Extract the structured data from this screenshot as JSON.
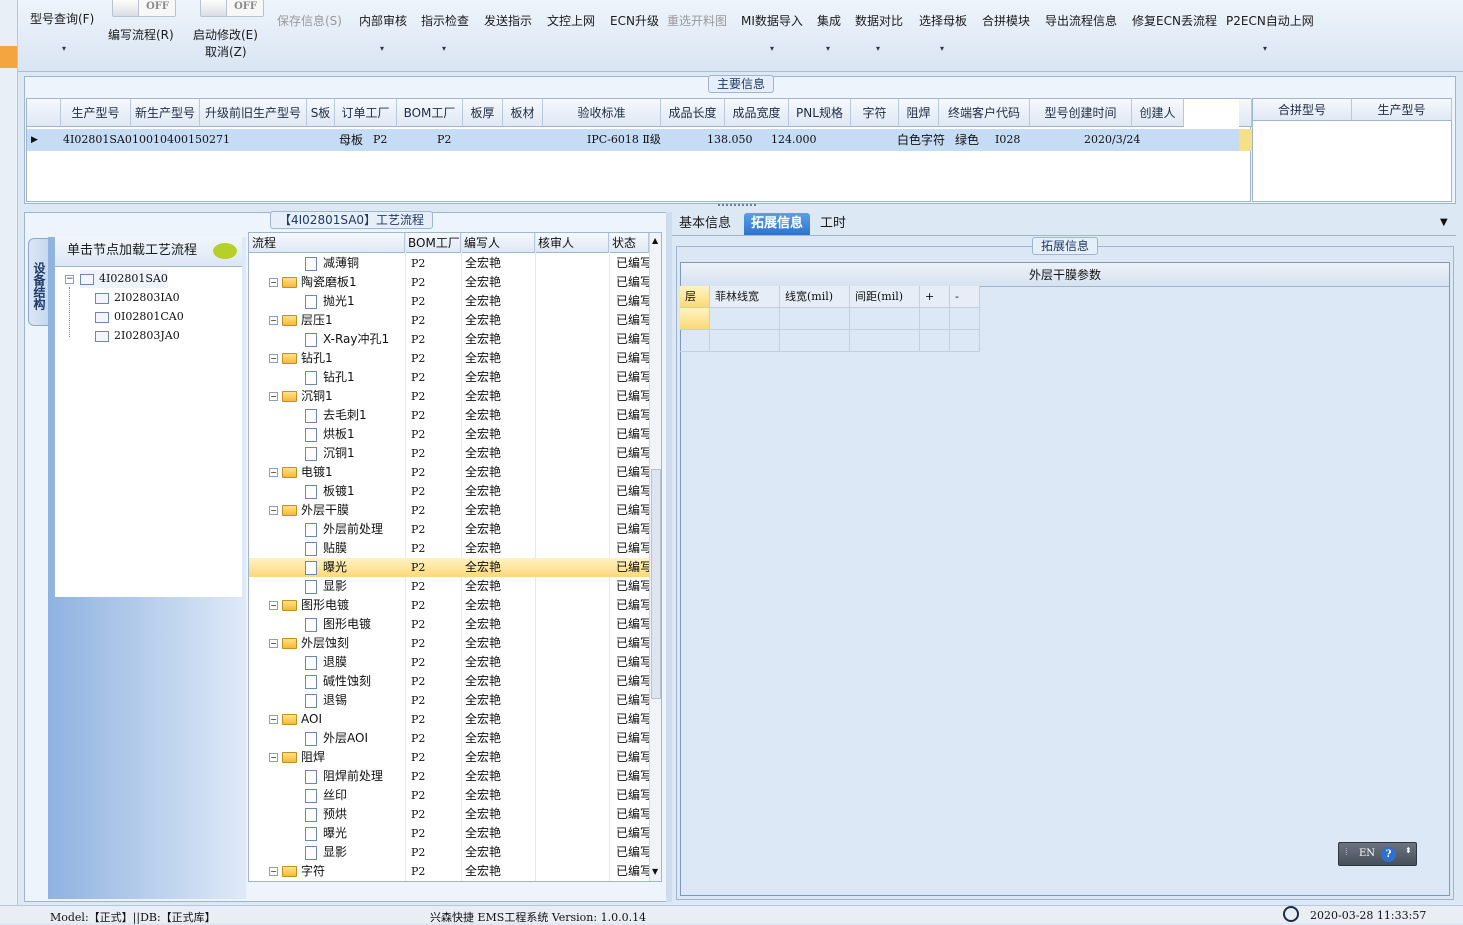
{
  "toolbar": {
    "query": "型号查询(F)",
    "write_flow": "编写流程(R)",
    "enable_edit": "启动修改(E)",
    "cancel": "取消(Z)",
    "toggle_off": "OFF",
    "save_info": "保存信息(S)",
    "internal_review": "内部审核",
    "instruction_check": "指示检查",
    "send_instruction": "发送指示",
    "doc_online": "文控上网",
    "ecn_upgrade": "ECN升级",
    "reopen_cut": "重选开料图",
    "mi_import": "MI数据导入",
    "integrate": "集成",
    "data_compare": "数据对比",
    "select_mother": "选择母板",
    "merge_module": "合拼模块",
    "export_flow": "导出流程信息",
    "fix_ecn": "修复ECN丢流程",
    "p2ecn_auto": "P2ECN自动上网"
  },
  "main_info": {
    "title": "主要信息",
    "columns": [
      "生产型号",
      "新生产型号",
      "升级前旧生产型号",
      "S板",
      "订单工厂",
      "BOM工厂",
      "板厚",
      "板材",
      "验收标准",
      "成品长度",
      "成品宽度",
      "PNL规格",
      "字符",
      "阻焊",
      "终端客户代码",
      "型号创建时间",
      "创建人"
    ],
    "row": {
      "prod_model": "4I02801SA0",
      "new_model": "10010400150271",
      "s_board": "母板",
      "order_factory": "P2",
      "bom_factory": "P2",
      "standard": "IPC-6018 Ⅱ级",
      "length": "138.050",
      "width": "124.000",
      "char": "白色字符",
      "solder": "绿色",
      "customer_code": "I028",
      "created": "2020/3/24"
    },
    "merge_columns": [
      "合拼型号",
      "生产型号"
    ]
  },
  "structure": {
    "vtab": "设备结构",
    "header": "单击节点加载工艺流程",
    "nodes": [
      "4I02801SA0",
      "2I02803IA0",
      "0I02801CA0",
      "2I02803JA0"
    ]
  },
  "flow": {
    "title": "【4I02801SA0】工艺流程",
    "columns": [
      "流程",
      "BOM工厂",
      "编写人",
      "核审人",
      "状态"
    ],
    "rows": [
      {
        "name": "减薄铜",
        "level": 2,
        "factory": "P2",
        "writer": "全宏艳",
        "status": "已编写"
      },
      {
        "name": "陶瓷磨板1",
        "level": 1,
        "factory": "P2",
        "writer": "全宏艳",
        "status": "已编写"
      },
      {
        "name": "抛光1",
        "level": 2,
        "factory": "P2",
        "writer": "全宏艳",
        "status": "已编写"
      },
      {
        "name": "层压1",
        "level": 1,
        "factory": "P2",
        "writer": "全宏艳",
        "status": "已编写"
      },
      {
        "name": "X-Ray冲孔1",
        "level": 2,
        "factory": "P2",
        "writer": "全宏艳",
        "status": "已编写"
      },
      {
        "name": "钻孔1",
        "level": 1,
        "factory": "P2",
        "writer": "全宏艳",
        "status": "已编写"
      },
      {
        "name": "钻孔1",
        "level": 2,
        "factory": "P2",
        "writer": "全宏艳",
        "status": "已编写"
      },
      {
        "name": "沉铜1",
        "level": 1,
        "factory": "P2",
        "writer": "全宏艳",
        "status": "已编写"
      },
      {
        "name": "去毛刺1",
        "level": 2,
        "factory": "P2",
        "writer": "全宏艳",
        "status": "已编写"
      },
      {
        "name": "烘板1",
        "level": 2,
        "factory": "P2",
        "writer": "全宏艳",
        "status": "已编写"
      },
      {
        "name": "沉铜1",
        "level": 2,
        "factory": "P2",
        "writer": "全宏艳",
        "status": "已编写"
      },
      {
        "name": "电镀1",
        "level": 1,
        "factory": "P2",
        "writer": "全宏艳",
        "status": "已编写"
      },
      {
        "name": "板镀1",
        "level": 2,
        "factory": "P2",
        "writer": "全宏艳",
        "status": "已编写"
      },
      {
        "name": "外层干膜",
        "level": 1,
        "factory": "P2",
        "writer": "全宏艳",
        "status": "已编写"
      },
      {
        "name": "外层前处理",
        "level": 2,
        "factory": "P2",
        "writer": "全宏艳",
        "status": "已编写"
      },
      {
        "name": "贴膜",
        "level": 2,
        "factory": "P2",
        "writer": "全宏艳",
        "status": "已编写"
      },
      {
        "name": "曝光",
        "level": 2,
        "factory": "P2",
        "writer": "全宏艳",
        "status": "已编写",
        "selected": true
      },
      {
        "name": "显影",
        "level": 2,
        "factory": "P2",
        "writer": "全宏艳",
        "status": "已编写"
      },
      {
        "name": "图形电镀",
        "level": 1,
        "factory": "P2",
        "writer": "全宏艳",
        "status": "已编写"
      },
      {
        "name": "图形电镀",
        "level": 2,
        "factory": "P2",
        "writer": "全宏艳",
        "status": "已编写"
      },
      {
        "name": "外层蚀刻",
        "level": 1,
        "factory": "P2",
        "writer": "全宏艳",
        "status": "已编写"
      },
      {
        "name": "退膜",
        "level": 2,
        "factory": "P2",
        "writer": "全宏艳",
        "status": "已编写"
      },
      {
        "name": "碱性蚀刻",
        "level": 2,
        "factory": "P2",
        "writer": "全宏艳",
        "status": "已编写"
      },
      {
        "name": "退锡",
        "level": 2,
        "factory": "P2",
        "writer": "全宏艳",
        "status": "已编写"
      },
      {
        "name": "AOI",
        "level": 1,
        "factory": "P2",
        "writer": "全宏艳",
        "status": "已编写"
      },
      {
        "name": "外层AOI",
        "level": 2,
        "factory": "P2",
        "writer": "全宏艳",
        "status": "已编写"
      },
      {
        "name": "阻焊",
        "level": 1,
        "factory": "P2",
        "writer": "全宏艳",
        "status": "已编写"
      },
      {
        "name": "阻焊前处理",
        "level": 2,
        "factory": "P2",
        "writer": "全宏艳",
        "status": "已编写"
      },
      {
        "name": "丝印",
        "level": 2,
        "factory": "P2",
        "writer": "全宏艳",
        "status": "已编写"
      },
      {
        "name": "预烘",
        "level": 2,
        "factory": "P2",
        "writer": "全宏艳",
        "status": "已编写"
      },
      {
        "name": "曝光",
        "level": 2,
        "factory": "P2",
        "writer": "全宏艳",
        "status": "已编写"
      },
      {
        "name": "显影",
        "level": 2,
        "factory": "P2",
        "writer": "全宏艳",
        "status": "已编写"
      },
      {
        "name": "字符",
        "level": 1,
        "factory": "P2",
        "writer": "全宏艳",
        "status": "已编写"
      }
    ]
  },
  "right": {
    "tabs": [
      "基本信息",
      "拓展信息",
      "工时"
    ],
    "ext_title": "拓展信息",
    "param_title": "外层干膜参数",
    "param_columns": [
      "层",
      "菲林线宽",
      "线宽(mil)",
      "间距(mil)",
      "+",
      "-"
    ]
  },
  "ime": {
    "lang": "EN",
    "help": "?"
  },
  "status": {
    "model": "Model:【正式】||DB:【正式库】",
    "system": "兴森快捷 EMS工程系统 Version: 1.0.0.14",
    "datetime": "2020-03-28 11:33:57"
  },
  "colors": {
    "accent": "#2f74cc",
    "selected_row": "#fbd978",
    "grid_selected": "#c6dcf5"
  }
}
